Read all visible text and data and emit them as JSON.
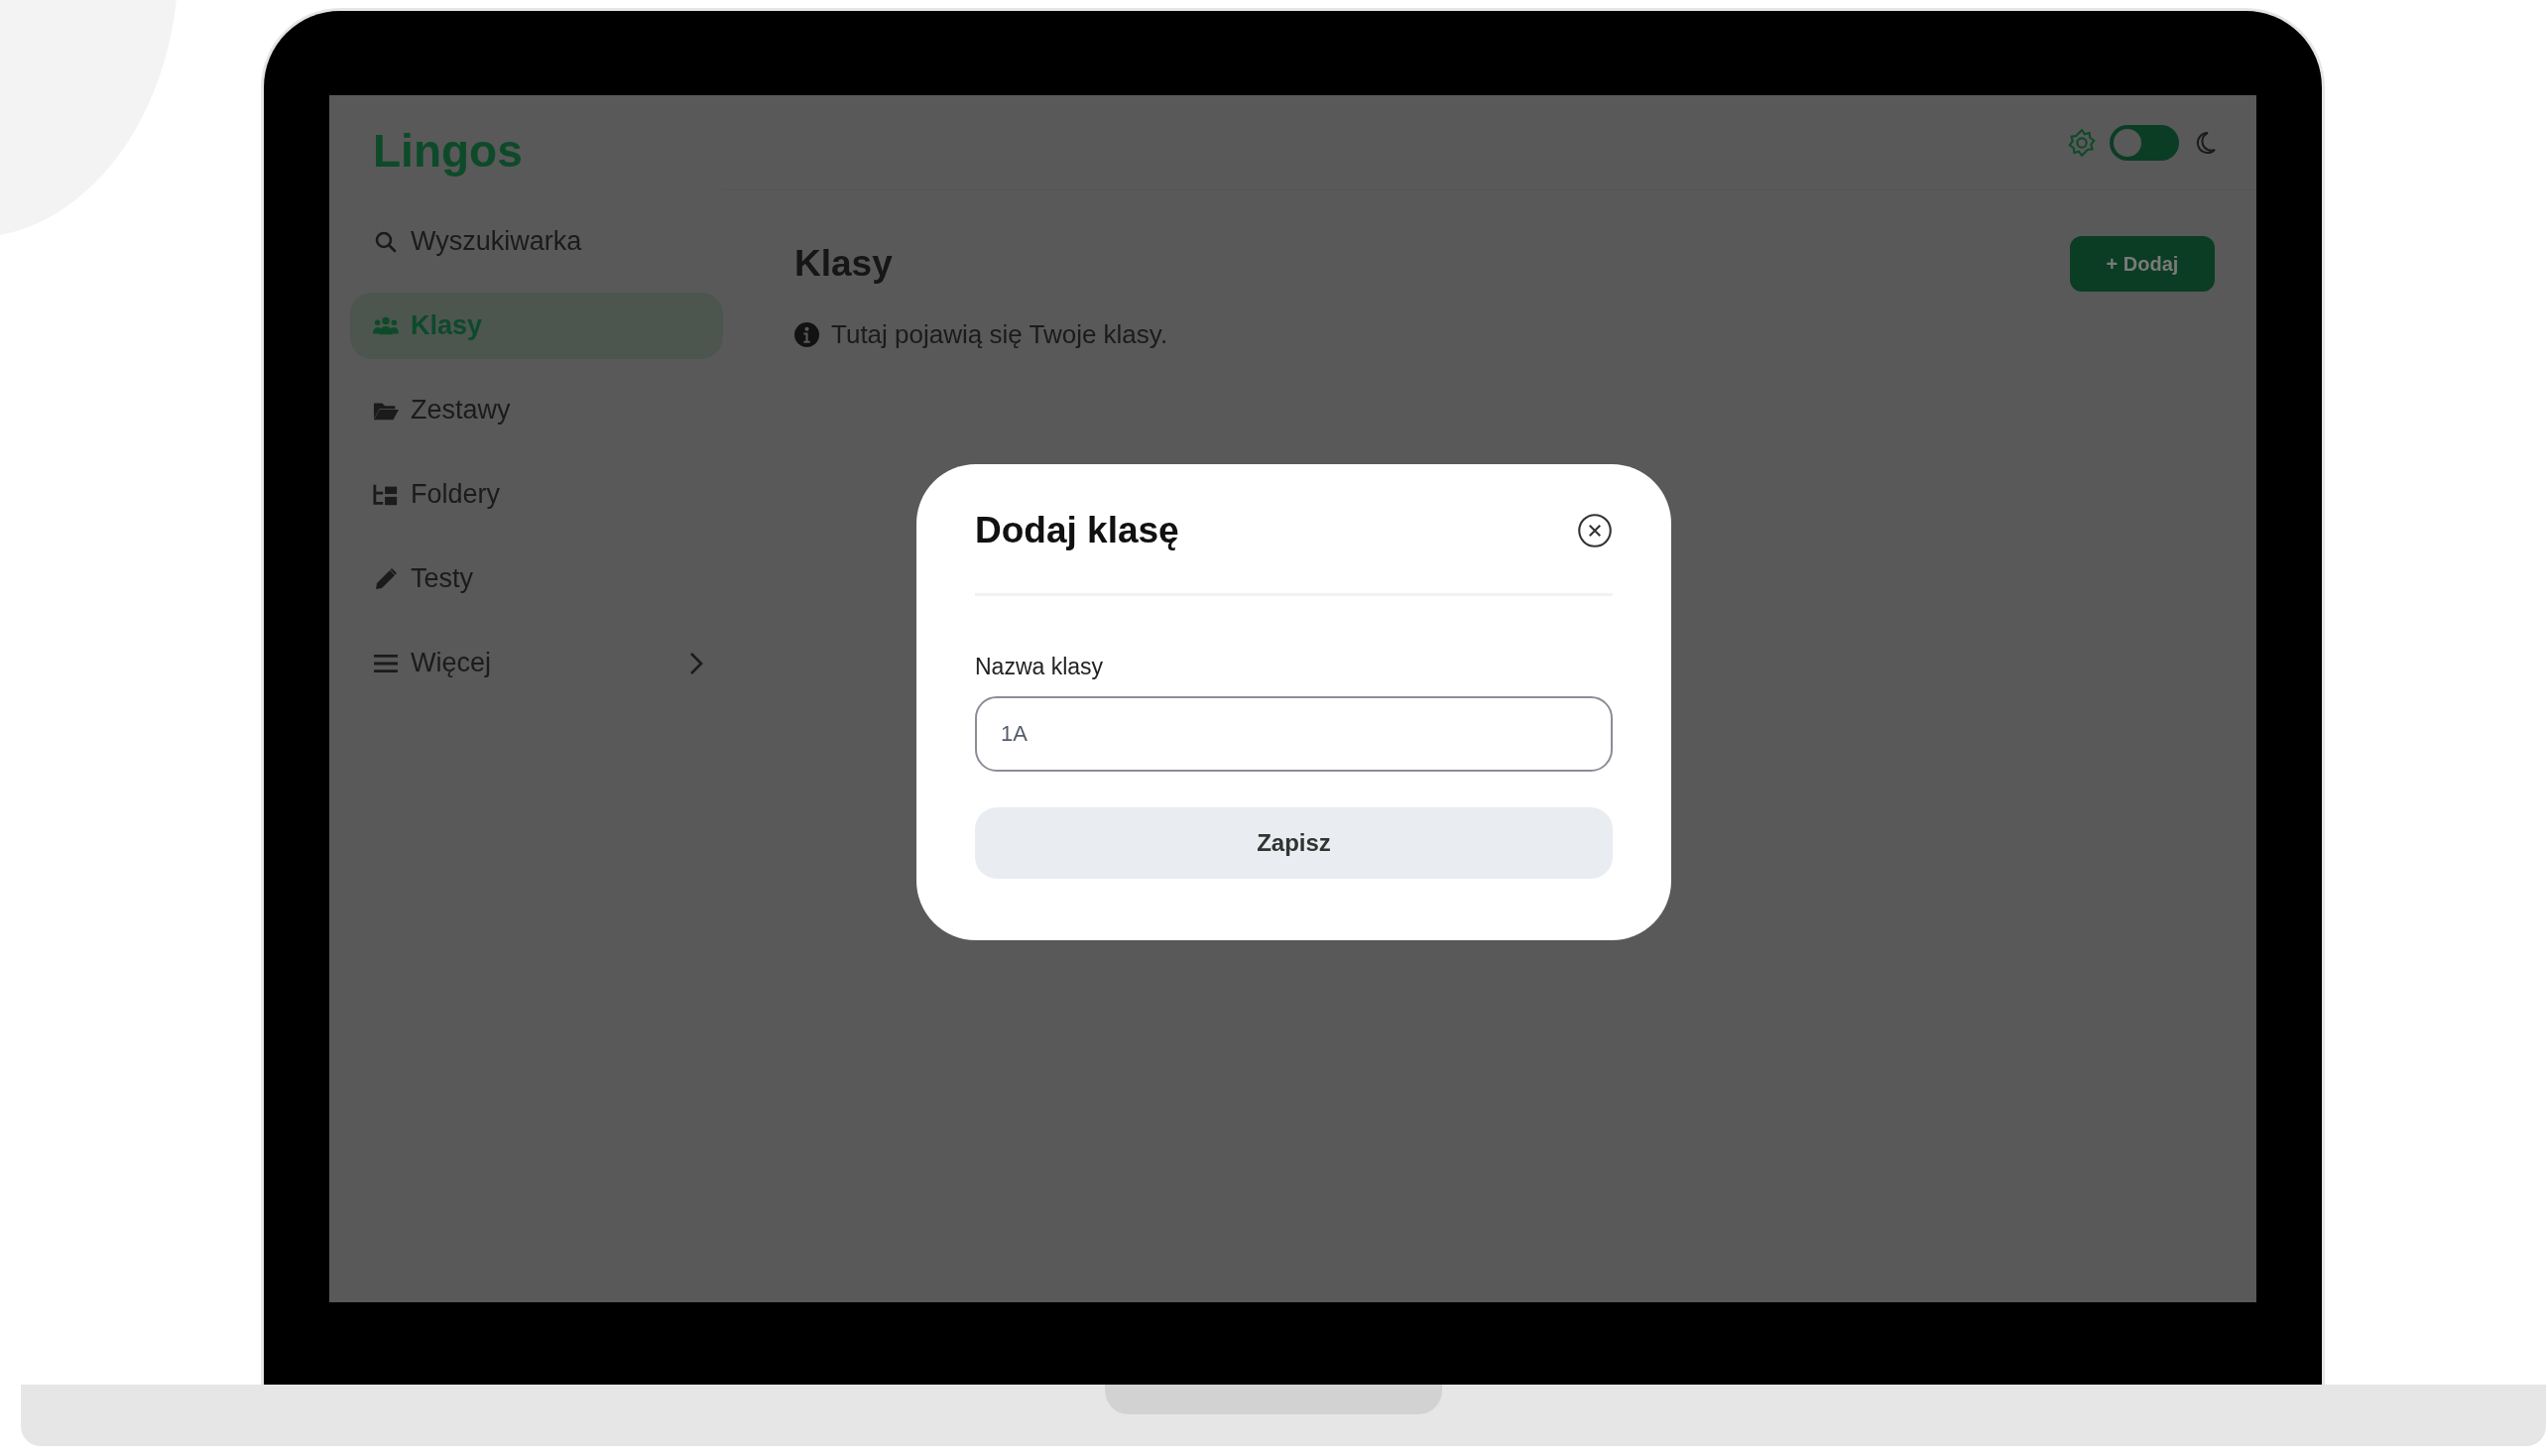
{
  "app": {
    "logo": "Lingos"
  },
  "sidebar": {
    "items": [
      {
        "label": "Wyszukiwarka",
        "kind": "search",
        "selected": false
      },
      {
        "label": "Klasy",
        "kind": "classes",
        "selected": true
      },
      {
        "label": "Zestawy",
        "kind": "sets",
        "selected": false
      },
      {
        "label": "Foldery",
        "kind": "folders",
        "selected": false
      },
      {
        "label": "Testy",
        "kind": "tests",
        "selected": false
      },
      {
        "label": "Więcej",
        "kind": "submenu",
        "selected": false
      }
    ]
  },
  "theme_toggle": {
    "on": false
  },
  "page": {
    "title": "Klasy",
    "add_button": "+ Dodaj",
    "info": "Tutaj pojawią się Twoje klasy."
  },
  "modal": {
    "title": "Dodaj klasę",
    "field_label": "Nazwa klasy",
    "field_value": "1A",
    "submit": "Zapisz"
  }
}
